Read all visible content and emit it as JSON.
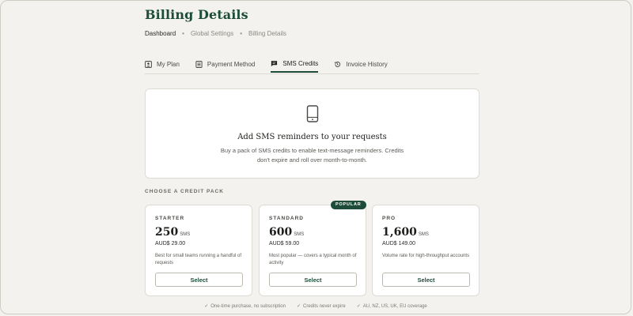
{
  "page": {
    "title": "Billing Details"
  },
  "breadcrumb": [
    "Dashboard",
    "Global Settings",
    "Billing Details"
  ],
  "tabs": [
    {
      "label": "My Plan",
      "icon": "user-card-icon",
      "active": false
    },
    {
      "label": "Payment Method",
      "icon": "receipt-icon",
      "active": false
    },
    {
      "label": "SMS Credits",
      "icon": "message-icon",
      "active": true
    },
    {
      "label": "Invoice History",
      "icon": "history-icon",
      "active": false
    }
  ],
  "hero": {
    "icon": "phone-icon",
    "title": "Add SMS reminders to your requests",
    "description": "Buy a pack of SMS credits to enable text-message reminders. Credits don't expire and roll over month-to-month."
  },
  "packs_section": {
    "label": "CHOOSE A CREDIT PACK"
  },
  "packs": [
    {
      "name": "STARTER",
      "quantity": "250",
      "unit": "SMS",
      "price": "AUD$ 29.00",
      "description": "Best for small teams running a handful of requests",
      "button": "Select",
      "badge": ""
    },
    {
      "name": "STANDARD",
      "quantity": "600",
      "unit": "SMS",
      "price": "AUD$ 59.00",
      "description": "Most popular — covers a typical month of activity",
      "button": "Select",
      "badge": "POPULAR"
    },
    {
      "name": "PRO",
      "quantity": "1,600",
      "unit": "SMS",
      "price": "AUD$ 149.00",
      "description": "Volume rate for high-throughput accounts",
      "button": "Select",
      "badge": ""
    }
  ],
  "footnotes": [
    {
      "check": "✓",
      "text": "One-time purchase, no subscription"
    },
    {
      "check": "✓",
      "text": "Credits never expire"
    },
    {
      "check": "✓",
      "text": "AU, NZ, US, UK, EU coverage"
    }
  ],
  "colors": {
    "accent": "#1d4d3a",
    "background": "#f4f2ee",
    "card": "#ffffff"
  }
}
